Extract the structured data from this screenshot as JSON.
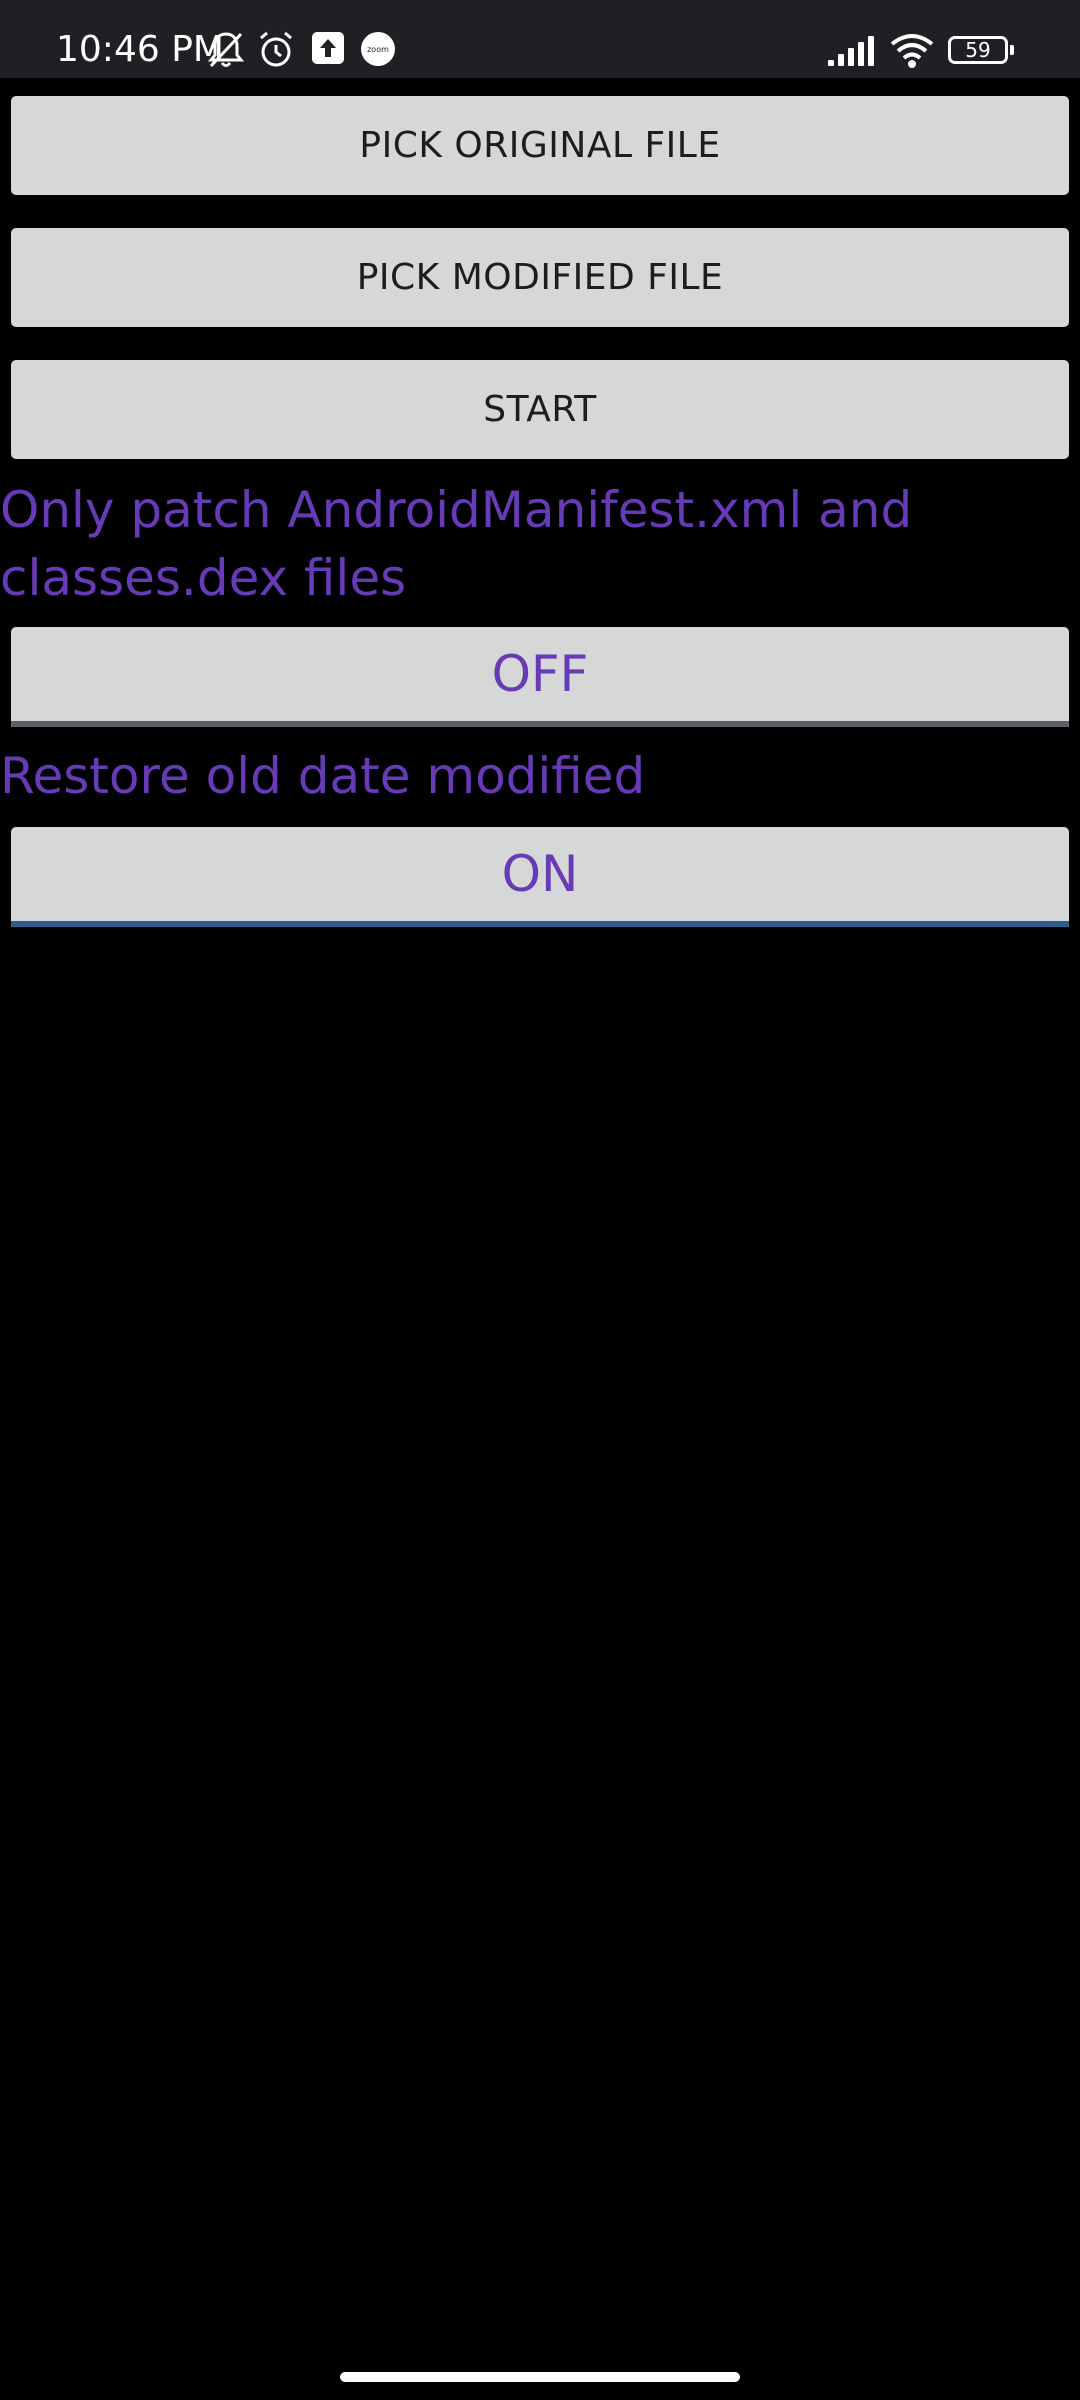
{
  "status_bar": {
    "time": "10:46 PM",
    "battery_level": "59",
    "zoom_label": "zoom",
    "icons": [
      "bell-off-icon",
      "alarm-icon",
      "upload-icon",
      "zoom-icon",
      "signal-icon",
      "wifi-icon",
      "battery-icon"
    ]
  },
  "actions": {
    "pick_original": "PICK ORIGINAL FILE",
    "pick_modified": "PICK MODIFIED FILE",
    "start": "START"
  },
  "options": {
    "patch_label": "Only patch AndroidManifest.xml and classes.dex files",
    "patch_state": "OFF",
    "restore_label": "Restore old date modified",
    "restore_state": "ON"
  },
  "colors": {
    "accent": "#673ab7",
    "button_bg": "#d6d7d7",
    "status_bar_bg": "#1f2023",
    "background": "#000000"
  }
}
